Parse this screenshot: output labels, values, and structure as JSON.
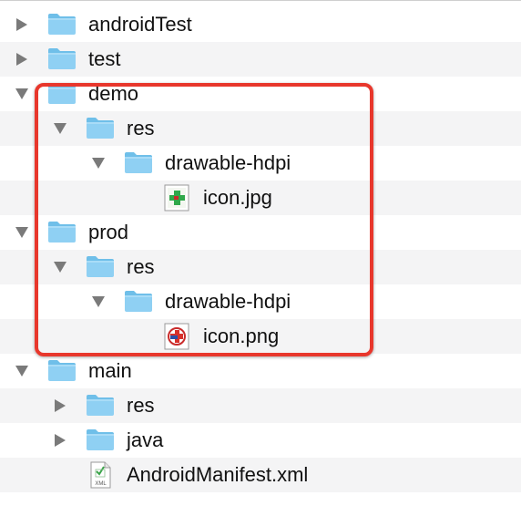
{
  "tree": {
    "rows": [
      {
        "label": "androidTest",
        "type": "folder",
        "expanded": false
      },
      {
        "label": "test",
        "type": "folder",
        "expanded": false
      },
      {
        "label": "demo",
        "type": "folder",
        "expanded": true
      },
      {
        "label": "res",
        "type": "folder",
        "expanded": true
      },
      {
        "label": "drawable-hdpi",
        "type": "folder",
        "expanded": true
      },
      {
        "label": "icon.jpg",
        "type": "file",
        "icon": "green-plus-image-icon"
      },
      {
        "label": "prod",
        "type": "folder",
        "expanded": true
      },
      {
        "label": "res",
        "type": "folder",
        "expanded": true
      },
      {
        "label": "drawable-hdpi",
        "type": "folder",
        "expanded": true
      },
      {
        "label": "icon.png",
        "type": "file",
        "icon": "red-blue-cross-image-icon"
      },
      {
        "label": "main",
        "type": "folder",
        "expanded": true
      },
      {
        "label": "res",
        "type": "folder",
        "expanded": false
      },
      {
        "label": "java",
        "type": "folder",
        "expanded": false
      },
      {
        "label": "AndroidManifest.xml",
        "type": "file",
        "icon": "xml-file-icon"
      }
    ]
  },
  "highlight": {
    "color": "#e8372c"
  },
  "colors": {
    "folder": "#8fd0f3",
    "folder_tab": "#6fbfe9",
    "stripe": "#f4f4f5",
    "triangle": "#7a7a7a"
  },
  "icons": {
    "xml_badge": "XML"
  }
}
